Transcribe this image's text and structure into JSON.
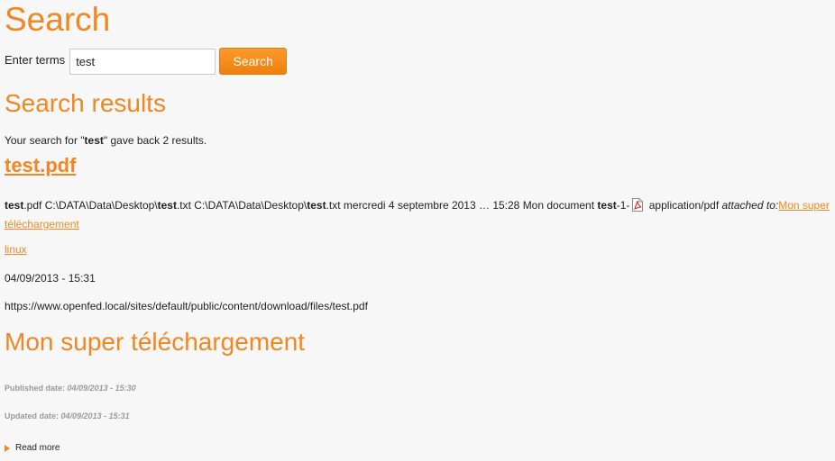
{
  "header": {
    "title": "Search"
  },
  "search_form": {
    "label": "Enter terms",
    "input_value": "test",
    "button_label": "Search"
  },
  "results": {
    "heading": "Search results",
    "summary_prefix": "Your search for \"",
    "summary_term": "test",
    "summary_suffix": "\" gave back 2 results."
  },
  "result_1": {
    "title": "test.pdf",
    "snippet": {
      "b1": "test",
      "t1": ".pdf C:\\DATA\\Data\\Desktop\\",
      "b2": "test",
      "t2": ".txt C:\\DATA\\Data\\Desktop\\",
      "b3": "test",
      "t3": ".txt mercredi 4 septembre 2013 … 15:28 Mon document ",
      "b4": "test",
      "t4": "-1-",
      "t5": " application/pdf ",
      "attached": "attached to:",
      "attached_link": "Mon super téléchargement"
    },
    "tag": "linux",
    "date": "04/09/2013 - 15:31",
    "url": "https://www.openfed.local/sites/default/public/content/download/files/test.pdf"
  },
  "result_2": {
    "title": "Mon super téléchargement",
    "published_label": "Published date:",
    "published_value": "04/09/2013 - 15:30",
    "updated_label": "Updated date:",
    "updated_value": "04/09/2013 - 15:31",
    "read_more": "Read more"
  },
  "colors": {
    "accent": "#f08722",
    "background": "#f7f7f7",
    "muted": "#9a9a9a"
  },
  "icons": {
    "pdf": "pdf-file-icon",
    "read_more": "triangle-right-icon"
  }
}
